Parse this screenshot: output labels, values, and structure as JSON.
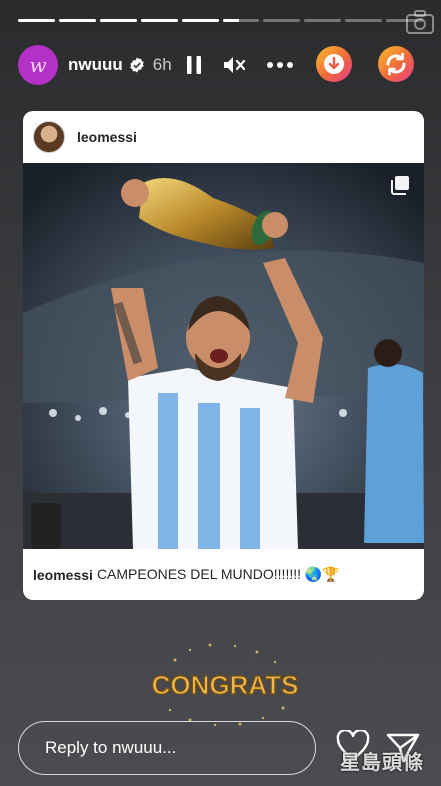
{
  "story": {
    "progress": [
      1,
      1,
      1,
      1,
      1,
      0.45,
      0,
      0,
      0,
      0
    ],
    "username": "nwuuu",
    "avatar_letter": "w",
    "time": "6h"
  },
  "post": {
    "username": "leomessi",
    "caption_user": "leomessi",
    "caption_text": "CAMPEONES DEL MUNDO!!!!!!! 🌏🏆"
  },
  "sticker": {
    "text": "CONGRATS"
  },
  "reply": {
    "placeholder": "Reply to nwuuu..."
  },
  "watermark": {
    "text": "星島頭條"
  },
  "icons": {
    "camera": "camera-icon",
    "verified": "verified-badge-icon",
    "pause": "pause-icon",
    "mute": "speaker-muted-icon",
    "more": "more-dots-icon",
    "download": "download-icon",
    "sync": "sync-icon",
    "multi": "multiple-photos-icon",
    "heart": "heart-icon",
    "send": "send-icon"
  },
  "colors": {
    "avatar": "#b431c8",
    "accent_gradient_start": "#f9a825",
    "accent_gradient_end": "#e8398f"
  }
}
